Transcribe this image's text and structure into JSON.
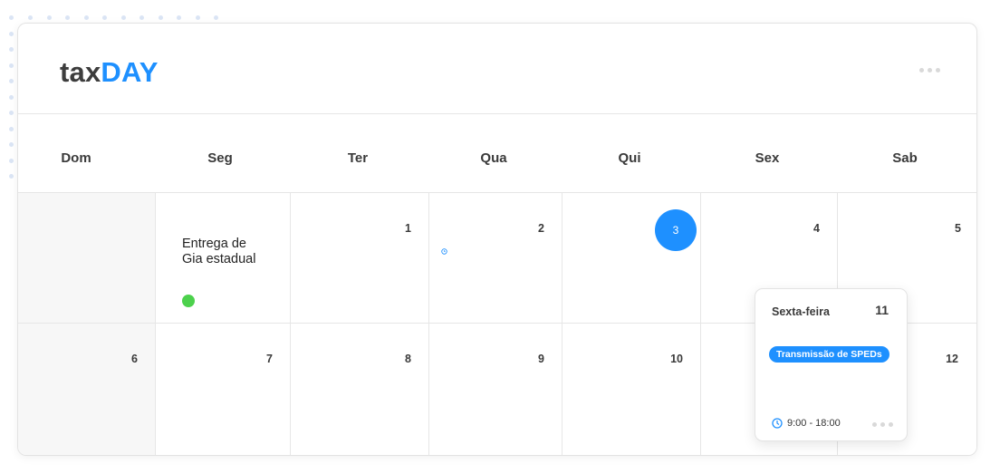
{
  "brand": {
    "part1": "tax",
    "part2": "DAY"
  },
  "weekdays": [
    "Dom",
    "Seg",
    "Ter",
    "Qua",
    "Qui",
    "Sex",
    "Sab"
  ],
  "week1": {
    "days": [
      "",
      "",
      "1",
      "2",
      "3",
      "4",
      "5"
    ],
    "event": {
      "title_line1": "Entrega de",
      "title_line2": "Gia estadual",
      "dot_color": "#4cd14c"
    }
  },
  "week2": {
    "days": [
      "6",
      "7",
      "8",
      "9",
      "10",
      "",
      "12"
    ]
  },
  "today": "3",
  "popup": {
    "day_name": "Sexta-feira",
    "day_number": "11",
    "tag": "Transmissão de SPEDs",
    "time": "9:00 - 18:00"
  },
  "colors": {
    "accent": "#1e90ff",
    "event_dot": "#4cd14c",
    "text": "#3a3a3a"
  },
  "icons": {
    "time": "clock-icon",
    "more": "more-dots-icon"
  }
}
